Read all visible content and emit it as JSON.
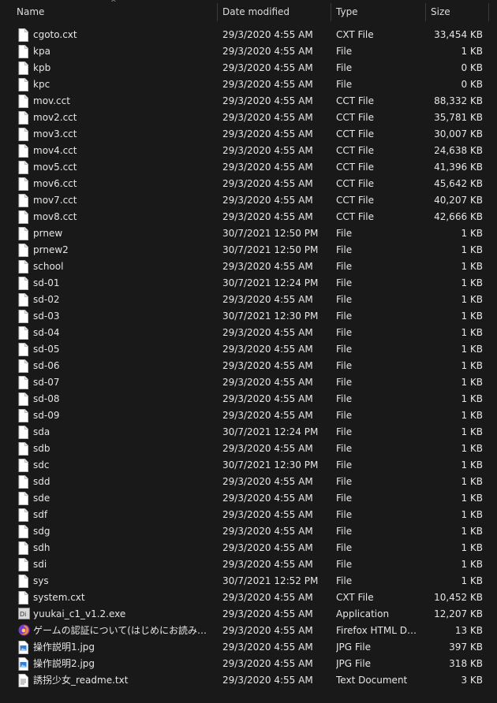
{
  "columns": {
    "name": "Name",
    "date": "Date modified",
    "type": "Type",
    "size": "Size"
  },
  "sort_indicator": "^",
  "files": [
    {
      "name": "cgoto.cxt",
      "date": "29/3/2020 4:55 AM",
      "type": "CXT File",
      "size": "33,454 KB",
      "icon": "file-icon"
    },
    {
      "name": "kpa",
      "date": "29/3/2020 4:55 AM",
      "type": "File",
      "size": "1 KB",
      "icon": "file-icon"
    },
    {
      "name": "kpb",
      "date": "29/3/2020 4:55 AM",
      "type": "File",
      "size": "0 KB",
      "icon": "file-icon"
    },
    {
      "name": "kpc",
      "date": "29/3/2020 4:55 AM",
      "type": "File",
      "size": "0 KB",
      "icon": "file-icon"
    },
    {
      "name": "mov.cct",
      "date": "29/3/2020 4:55 AM",
      "type": "CCT File",
      "size": "88,332 KB",
      "icon": "file-icon"
    },
    {
      "name": "mov2.cct",
      "date": "29/3/2020 4:55 AM",
      "type": "CCT File",
      "size": "35,781 KB",
      "icon": "file-icon"
    },
    {
      "name": "mov3.cct",
      "date": "29/3/2020 4:55 AM",
      "type": "CCT File",
      "size": "30,007 KB",
      "icon": "file-icon"
    },
    {
      "name": "mov4.cct",
      "date": "29/3/2020 4:55 AM",
      "type": "CCT File",
      "size": "24,638 KB",
      "icon": "file-icon"
    },
    {
      "name": "mov5.cct",
      "date": "29/3/2020 4:55 AM",
      "type": "CCT File",
      "size": "41,396 KB",
      "icon": "file-icon"
    },
    {
      "name": "mov6.cct",
      "date": "29/3/2020 4:55 AM",
      "type": "CCT File",
      "size": "45,642 KB",
      "icon": "file-icon"
    },
    {
      "name": "mov7.cct",
      "date": "29/3/2020 4:55 AM",
      "type": "CCT File",
      "size": "40,207 KB",
      "icon": "file-icon"
    },
    {
      "name": "mov8.cct",
      "date": "29/3/2020 4:55 AM",
      "type": "CCT File",
      "size": "42,666 KB",
      "icon": "file-icon"
    },
    {
      "name": "prnew",
      "date": "30/7/2021 12:50 PM",
      "type": "File",
      "size": "1 KB",
      "icon": "file-icon"
    },
    {
      "name": "prnew2",
      "date": "30/7/2021 12:50 PM",
      "type": "File",
      "size": "1 KB",
      "icon": "file-icon"
    },
    {
      "name": "school",
      "date": "29/3/2020 4:55 AM",
      "type": "File",
      "size": "1 KB",
      "icon": "file-icon"
    },
    {
      "name": "sd-01",
      "date": "30/7/2021 12:24 PM",
      "type": "File",
      "size": "1 KB",
      "icon": "file-icon"
    },
    {
      "name": "sd-02",
      "date": "29/3/2020 4:55 AM",
      "type": "File",
      "size": "1 KB",
      "icon": "file-icon"
    },
    {
      "name": "sd-03",
      "date": "30/7/2021 12:30 PM",
      "type": "File",
      "size": "1 KB",
      "icon": "file-icon"
    },
    {
      "name": "sd-04",
      "date": "29/3/2020 4:55 AM",
      "type": "File",
      "size": "1 KB",
      "icon": "file-icon"
    },
    {
      "name": "sd-05",
      "date": "29/3/2020 4:55 AM",
      "type": "File",
      "size": "1 KB",
      "icon": "file-icon"
    },
    {
      "name": "sd-06",
      "date": "29/3/2020 4:55 AM",
      "type": "File",
      "size": "1 KB",
      "icon": "file-icon"
    },
    {
      "name": "sd-07",
      "date": "29/3/2020 4:55 AM",
      "type": "File",
      "size": "1 KB",
      "icon": "file-icon"
    },
    {
      "name": "sd-08",
      "date": "29/3/2020 4:55 AM",
      "type": "File",
      "size": "1 KB",
      "icon": "file-icon"
    },
    {
      "name": "sd-09",
      "date": "29/3/2020 4:55 AM",
      "type": "File",
      "size": "1 KB",
      "icon": "file-icon"
    },
    {
      "name": "sda",
      "date": "30/7/2021 12:24 PM",
      "type": "File",
      "size": "1 KB",
      "icon": "file-icon"
    },
    {
      "name": "sdb",
      "date": "29/3/2020 4:55 AM",
      "type": "File",
      "size": "1 KB",
      "icon": "file-icon"
    },
    {
      "name": "sdc",
      "date": "30/7/2021 12:30 PM",
      "type": "File",
      "size": "1 KB",
      "icon": "file-icon"
    },
    {
      "name": "sdd",
      "date": "29/3/2020 4:55 AM",
      "type": "File",
      "size": "1 KB",
      "icon": "file-icon"
    },
    {
      "name": "sde",
      "date": "29/3/2020 4:55 AM",
      "type": "File",
      "size": "1 KB",
      "icon": "file-icon"
    },
    {
      "name": "sdf",
      "date": "29/3/2020 4:55 AM",
      "type": "File",
      "size": "1 KB",
      "icon": "file-icon"
    },
    {
      "name": "sdg",
      "date": "29/3/2020 4:55 AM",
      "type": "File",
      "size": "1 KB",
      "icon": "file-icon"
    },
    {
      "name": "sdh",
      "date": "29/3/2020 4:55 AM",
      "type": "File",
      "size": "1 KB",
      "icon": "file-icon"
    },
    {
      "name": "sdi",
      "date": "29/3/2020 4:55 AM",
      "type": "File",
      "size": "1 KB",
      "icon": "file-icon"
    },
    {
      "name": "sys",
      "date": "30/7/2021 12:52 PM",
      "type": "File",
      "size": "1 KB",
      "icon": "file-icon"
    },
    {
      "name": "system.cxt",
      "date": "29/3/2020 4:55 AM",
      "type": "CXT File",
      "size": "10,452 KB",
      "icon": "file-icon"
    },
    {
      "name": "yuukai_c1_v1.2.exe",
      "date": "29/3/2020 4:55 AM",
      "type": "Application",
      "size": "12,207 KB",
      "icon": "application-icon"
    },
    {
      "name": "ゲームの認証について(はじめにお読みください)...",
      "date": "29/3/2020 4:55 AM",
      "type": "Firefox HTML Doc...",
      "size": "13 KB",
      "icon": "firefox-icon"
    },
    {
      "name": "操作説明1.jpg",
      "date": "29/3/2020 4:55 AM",
      "type": "JPG File",
      "size": "397 KB",
      "icon": "image-file-icon"
    },
    {
      "name": "操作説明2.jpg",
      "date": "29/3/2020 4:55 AM",
      "type": "JPG File",
      "size": "318 KB",
      "icon": "image-file-icon"
    },
    {
      "name": "誘拐少女_readme.txt",
      "date": "29/3/2020 4:55 AM",
      "type": "Text Document",
      "size": "3 KB",
      "icon": "text-file-icon"
    }
  ],
  "colors": {
    "background": "#191919",
    "text": "#e6e6e6",
    "header_separator": "#3a3a3a"
  }
}
